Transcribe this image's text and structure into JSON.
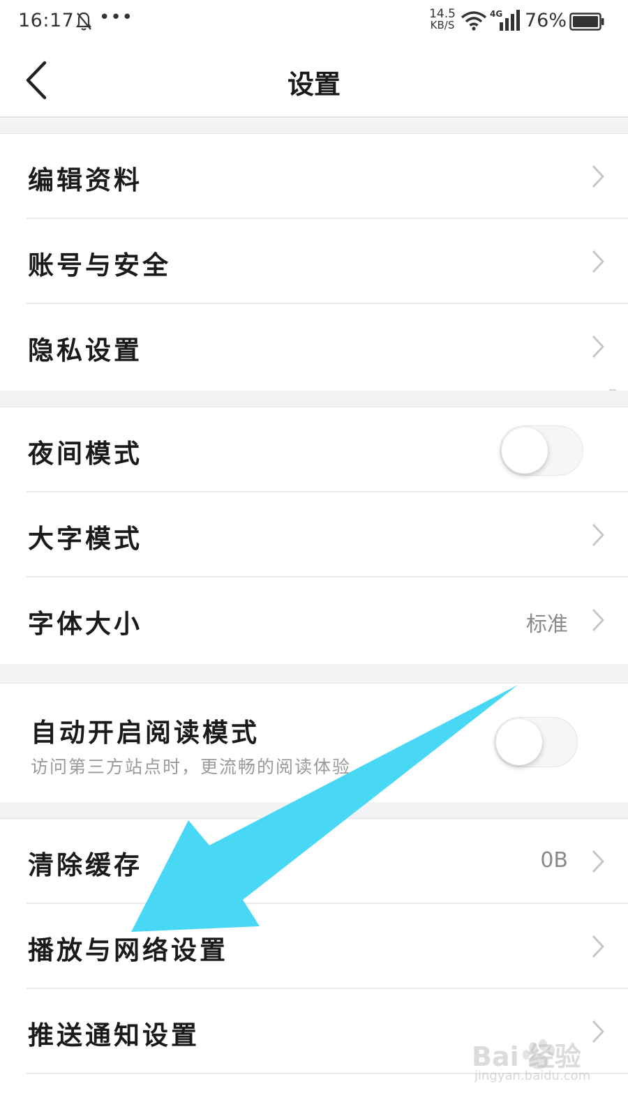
{
  "status_bar": {
    "time": "16:17",
    "more": "•••",
    "net_speed_value": "14.5",
    "net_speed_unit": "KB/S",
    "network": "4G",
    "battery": "76%"
  },
  "header": {
    "title": "设置",
    "back_icon": "chevron-left-icon"
  },
  "sections": [
    {
      "items": [
        {
          "label": "编辑资料",
          "type": "link"
        },
        {
          "label": "账号与安全",
          "type": "link"
        },
        {
          "label": "隐私设置",
          "type": "link"
        }
      ]
    },
    {
      "items": [
        {
          "label": "夜间模式",
          "type": "toggle",
          "on": false
        },
        {
          "label": "大字模式",
          "type": "link"
        },
        {
          "label": "字体大小",
          "type": "link",
          "value": "标准"
        }
      ]
    },
    {
      "items": [
        {
          "label": "自动开启阅读模式",
          "type": "toggle",
          "on": false,
          "subtitle": "访问第三方站点时，更流畅的阅读体验"
        }
      ]
    },
    {
      "items": [
        {
          "label": "清除缓存",
          "type": "link",
          "value": "0B"
        },
        {
          "label": "播放与网络设置",
          "type": "link"
        },
        {
          "label": "推送通知设置",
          "type": "link"
        }
      ]
    }
  ],
  "annotation": {
    "arrow_color": "#48d8f5"
  },
  "watermark": {
    "text": "Bai 经验",
    "url": "jingyan.baidu.com"
  }
}
